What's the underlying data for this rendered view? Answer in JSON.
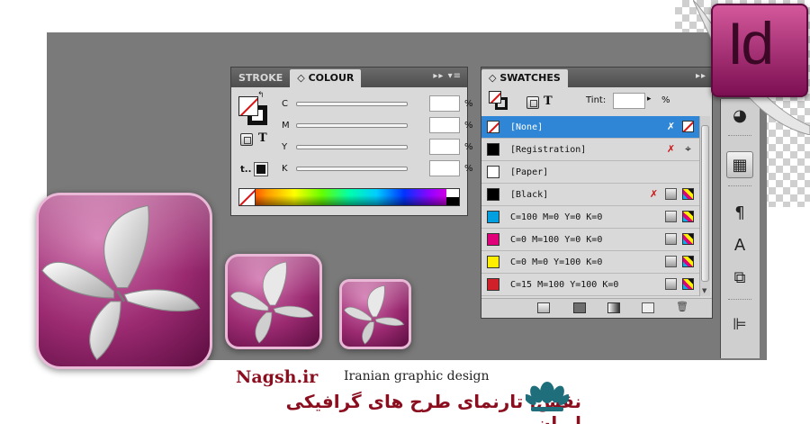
{
  "colour_panel": {
    "tabs": [
      "STROKE",
      "COLOUR"
    ],
    "active_tab_icon": "◇",
    "sliders": [
      {
        "label": "C",
        "value": "",
        "unit": "%"
      },
      {
        "label": "M",
        "value": "",
        "unit": "%"
      },
      {
        "label": "Y",
        "value": "",
        "unit": "%"
      },
      {
        "label": "K",
        "value": "",
        "unit": "%"
      }
    ],
    "format_label": "T",
    "tint_label": "t.."
  },
  "swatches_panel": {
    "tab": "SWATCHES",
    "tab_icon": "◇",
    "format_label": "T",
    "tint_label": "Tint:",
    "tint_value": "",
    "tint_unit": "%",
    "swatches": [
      {
        "name": "[None]",
        "color": "none",
        "selected": true
      },
      {
        "name": "[Registration]",
        "color": "#000000",
        "selected": false
      },
      {
        "name": "[Paper]",
        "color": "#ffffff",
        "selected": false
      },
      {
        "name": "[Black]",
        "color": "#000000",
        "selected": false
      },
      {
        "name": "C=100 M=0 Y=0 K=0",
        "color": "#00a0e0",
        "selected": false
      },
      {
        "name": "C=0 M=100 Y=0 K=0",
        "color": "#e0007a",
        "selected": false
      },
      {
        "name": "C=0 M=0 Y=100 K=0",
        "color": "#ffee00",
        "selected": false
      },
      {
        "name": "C=15 M=100 Y=100 K=0",
        "color": "#d0202a",
        "selected": false
      }
    ]
  },
  "logo": {
    "text": "Id"
  },
  "branding": {
    "latin": "Nagsh.ir",
    "subtitle": "Iranian graphic design",
    "persian": "نقش، تارنمای طرح های گرافیکی ایران"
  },
  "colors": {
    "accent": "#2f86d6",
    "canvas": "#7a7a7a",
    "panel": "#d9d9d9",
    "icon_purple": "#9b2a71"
  }
}
